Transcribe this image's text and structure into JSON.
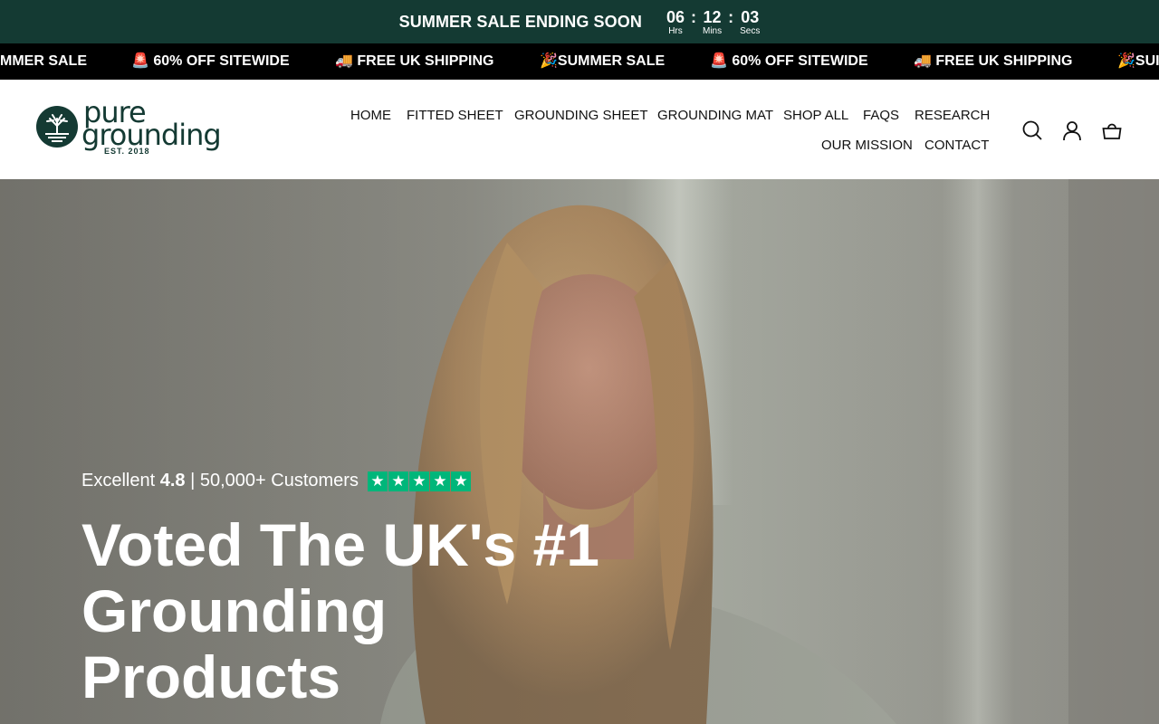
{
  "countdown": {
    "text": "SUMMER SALE ENDING SOON",
    "hours": "06",
    "minutes": "12",
    "seconds": "03",
    "hours_label": "Hrs",
    "minutes_label": "Mins",
    "seconds_label": "Secs",
    "separator": ":"
  },
  "marquee": {
    "items": [
      "MMER SALE",
      "🚨 60% OFF SITEWIDE",
      "🚚 FREE UK SHIPPING",
      "🎉SUMMER SALE",
      "🚨 60% OFF SITEWIDE",
      "🚚 FREE UK SHIPPING",
      "🎉SUI"
    ]
  },
  "logo": {
    "word1": "pure",
    "word2": "grounding",
    "est": "EST. 2018"
  },
  "nav": {
    "items": [
      "HOME",
      "FITTED SHEET",
      "GROUNDING SHEET",
      "GROUNDING MAT",
      "SHOP ALL",
      "FAQS",
      "RESEARCH",
      "OUR MISSION",
      "CONTACT"
    ]
  },
  "header_icons": [
    "search-icon",
    "account-icon",
    "cart-icon"
  ],
  "hero": {
    "rating_prefix": "Excellent",
    "rating_value": "4.8",
    "rating_suffix": "| 50,000+ Customers",
    "stars": 5,
    "title_lines": [
      "Voted The UK's #1",
      "Grounding",
      "Products"
    ]
  },
  "colors": {
    "brand_dark_green": "#143a33",
    "marquee_bg": "#000000",
    "trustpilot_green": "#00b67a"
  }
}
